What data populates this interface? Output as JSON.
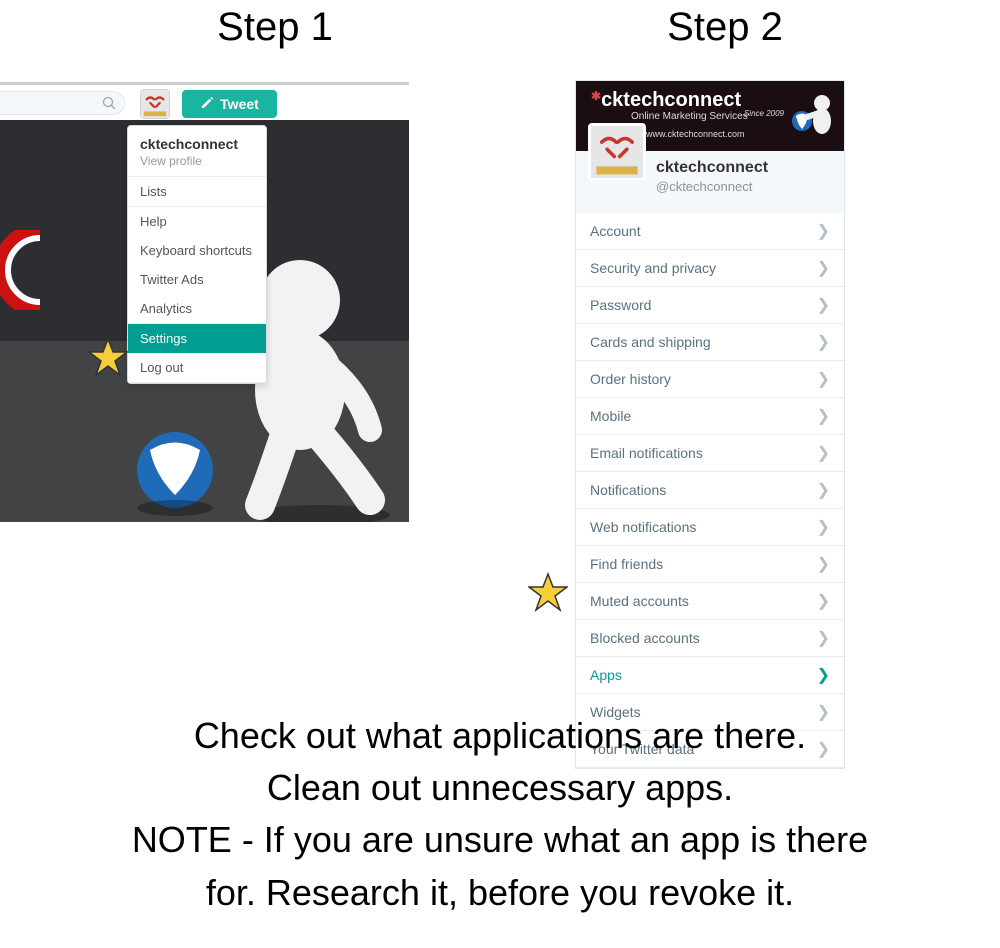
{
  "step1": {
    "title": "Step 1",
    "tweet_button": "Tweet",
    "dropdown": {
      "name": "cktechconnect",
      "view_profile": "View profile",
      "lists": "Lists",
      "help": "Help",
      "shortcuts": "Keyboard shortcuts",
      "ads": "Twitter Ads",
      "analytics": "Analytics",
      "settings": "Settings",
      "logout": "Log out"
    }
  },
  "step2": {
    "title": "Step 2",
    "header": {
      "brand": "cktechconnect",
      "tagline": "Online Marketing Services",
      "since": "Since 2009",
      "url": "www.cktechconnect.com"
    },
    "profile": {
      "name": "cktechconnect",
      "handle": "@cktechconnect"
    },
    "rows": [
      {
        "label": "Account",
        "active": false
      },
      {
        "label": "Security and privacy",
        "active": false
      },
      {
        "label": "Password",
        "active": false
      },
      {
        "label": "Cards and shipping",
        "active": false
      },
      {
        "label": "Order history",
        "active": false
      },
      {
        "label": "Mobile",
        "active": false
      },
      {
        "label": "Email notifications",
        "active": false
      },
      {
        "label": "Notifications",
        "active": false
      },
      {
        "label": "Web notifications",
        "active": false
      },
      {
        "label": "Find friends",
        "active": false
      },
      {
        "label": "Muted accounts",
        "active": false
      },
      {
        "label": "Blocked accounts",
        "active": false
      },
      {
        "label": "Apps",
        "active": true
      },
      {
        "label": "Widgets",
        "active": false
      },
      {
        "label": "Your Twitter data",
        "active": false
      }
    ]
  },
  "caption": {
    "line1": "Check out what applications are there.",
    "line2": "Clean out unnecessary apps.",
    "line3": "NOTE - If you are unsure what an app is there",
    "line4": "for. Research it, before you revoke it."
  }
}
